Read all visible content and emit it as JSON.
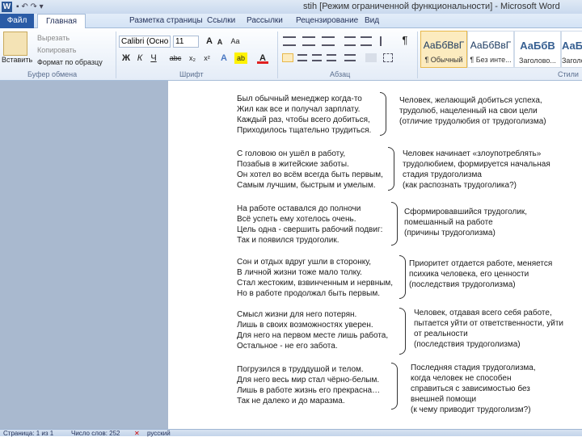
{
  "window": {
    "title": "stih [Режим ограниченной функциональности] - Microsoft Word",
    "app_letter": "W",
    "qat": "▪ ↶ ↷ ▾"
  },
  "tabs": [
    {
      "label": "Файл"
    },
    {
      "label": "Главная"
    },
    {
      "label": "Разметка страницы"
    },
    {
      "label": "Ссылки"
    },
    {
      "label": "Рассылки"
    },
    {
      "label": "Рецензирование"
    },
    {
      "label": "Вид"
    }
  ],
  "ribbon": {
    "clipboard": {
      "paste": "Вставить",
      "cut": "Вырезать",
      "copy": "Копировать",
      "format_painter": "Формат по образцу",
      "group": "Буфер обмена"
    },
    "font": {
      "name": "Calibri (Осно",
      "size": "11",
      "group": "Шрифт",
      "grow": "A",
      "shrink": "A",
      "clear": "Aa",
      "bold": "Ж",
      "italic": "К",
      "underline": "Ч",
      "strike": "abc",
      "sub": "x₂",
      "sup": "x²",
      "effects": "A",
      "highlight": "ab",
      "color": "A"
    },
    "paragraph": {
      "group": "Абзац",
      "marks": "¶"
    },
    "styles": {
      "group": "Стили",
      "items": [
        {
          "sample": "АаБбВвГ",
          "name": "¶ Обычный",
          "selected": true
        },
        {
          "sample": "АаБбВвГ",
          "name": "¶ Без инте...",
          "selected": false
        },
        {
          "sample": "АаБбВ",
          "name": "Заголово...",
          "selected": false
        },
        {
          "sample": "АаБбВ",
          "name": "Заголово...",
          "selected": false
        }
      ]
    }
  },
  "document": {
    "stanzas": [
      [
        "Был обычный менеджер когда-то",
        "Жил как все и получал зарплату.",
        "Каждый раз, чтобы всего добиться,",
        "Приходилось тщательно трудиться."
      ],
      [
        "С головою он ушёл в работу,",
        "Позабыв в житейские заботы.",
        "Он хотел во всём всегда быть первым,",
        "Самым лучшим, быстрым и умелым."
      ],
      [
        "На работе оставался до полночи",
        "Всё успеть ему хотелось очень.",
        "Цель одна - свершить рабочий подвиг:",
        "Так и появился трудоголик."
      ],
      [
        "Сон и отдых вдруг ушли в сторонку,",
        "В личной жизни тоже мало толку.",
        "Стал жестоким, взвинченным и нервным,",
        "Но в работе продолжал быть первым."
      ],
      [
        "Смысл жизни для него потерян.",
        "Лишь в своих возможностях уверен.",
        "Для него на первом месте лишь работа,",
        "Остальное - не его забота."
      ],
      [
        "Погрузился в труддушой и телом.",
        "Для него весь мир стал чёрно-белым.",
        "Лишь в работе жизнь его прекрасна…",
        "Так не далеко и до маразма."
      ]
    ],
    "notes": [
      [
        "Человек, желающий добиться успеха,",
        "трудолюб, нацеленный на свои цели",
        "(отличие трудолюбия от трудоголизма)"
      ],
      [
        "Человек начинает «злоупотреблять»",
        "трудолюбием, формируется начальная",
        "стадия трудоголизма",
        "(как распознать трудоголика?)"
      ],
      [
        "Сформировавшийся трудоголик,",
        "помешанный на работе",
        "(причины трудоголизма)"
      ],
      [
        "Приоритет отдается работе, меняется",
        "психика человека, его ценности",
        "(последствия трудоголизма)"
      ],
      [
        "Человек, отдавая всего себя работе,",
        "пытается уйти от ответственности, уйти",
        "от реальности",
        "(последствия трудоголизма)"
      ],
      [
        "Последняя стадия трудоголизма,",
        "когда человек не способен",
        "справиться с зависимостью без",
        "внешней помощи",
        "(к чему приводит трудоголизм?)"
      ]
    ]
  },
  "status": {
    "page": "Страница: 1 из 1",
    "words": "Число слов: 252",
    "lang": "русский"
  }
}
